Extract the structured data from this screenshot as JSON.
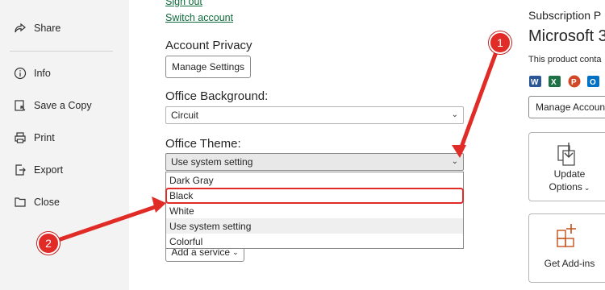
{
  "nav": {
    "items": [
      {
        "label": "Share",
        "icon": "share-icon"
      },
      {
        "label": "Info",
        "icon": "info-icon"
      },
      {
        "label": "Save a Copy",
        "icon": "save-copy-icon"
      },
      {
        "label": "Print",
        "icon": "print-icon"
      },
      {
        "label": "Export",
        "icon": "export-icon"
      },
      {
        "label": "Close",
        "icon": "close-folder-icon"
      }
    ]
  },
  "account": {
    "sign_out": "Sign out",
    "switch_account": "Switch account",
    "privacy_title": "Account Privacy",
    "manage_settings": "Manage Settings",
    "background_title": "Office Background:",
    "background_value": "Circuit",
    "theme_title": "Office Theme:",
    "theme_value": "Use system setting",
    "theme_options": [
      "Dark Gray",
      "Black",
      "White",
      "Use system setting",
      "Colorful"
    ],
    "add_service": "Add a service"
  },
  "subscription": {
    "heading": "Subscription P",
    "product": "Microsoft 3",
    "contains": "This product conta",
    "app_icons": [
      "word-icon",
      "excel-icon",
      "powerpoint-icon",
      "outlook-icon"
    ],
    "manage_account": "Manage Accoun",
    "update_options_line1": "Update",
    "update_options_line2": "Options",
    "get_addins": "Get Add-ins"
  },
  "annotations": {
    "step1": "1",
    "step2": "2",
    "color": "#e02b27"
  }
}
